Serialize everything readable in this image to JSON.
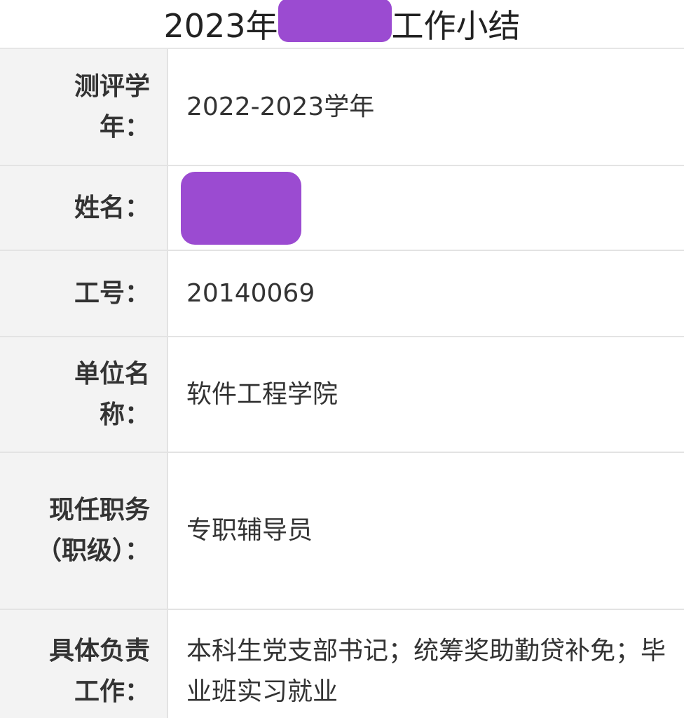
{
  "title": {
    "prefix": "2023年",
    "suffix": "工作小结"
  },
  "fields": {
    "year": {
      "label": "测评学年：",
      "value": "2022-2023学年"
    },
    "name": {
      "label": "姓名：",
      "value": ""
    },
    "staff_id": {
      "label": "工号：",
      "value": "20140069"
    },
    "unit": {
      "label": "单位名称：",
      "value": "软件工程学院"
    },
    "position": {
      "label": "现任职务（职级）：",
      "value": "专职辅导员"
    },
    "duties": {
      "label": "具体负责工作：",
      "value": "本科生党支部书记；统筹奖助勤贷补免；毕业班实习就业"
    }
  },
  "colors": {
    "redaction": "#9b4bd1",
    "label_bg": "#f3f3f3",
    "border": "#e3e3e3"
  }
}
